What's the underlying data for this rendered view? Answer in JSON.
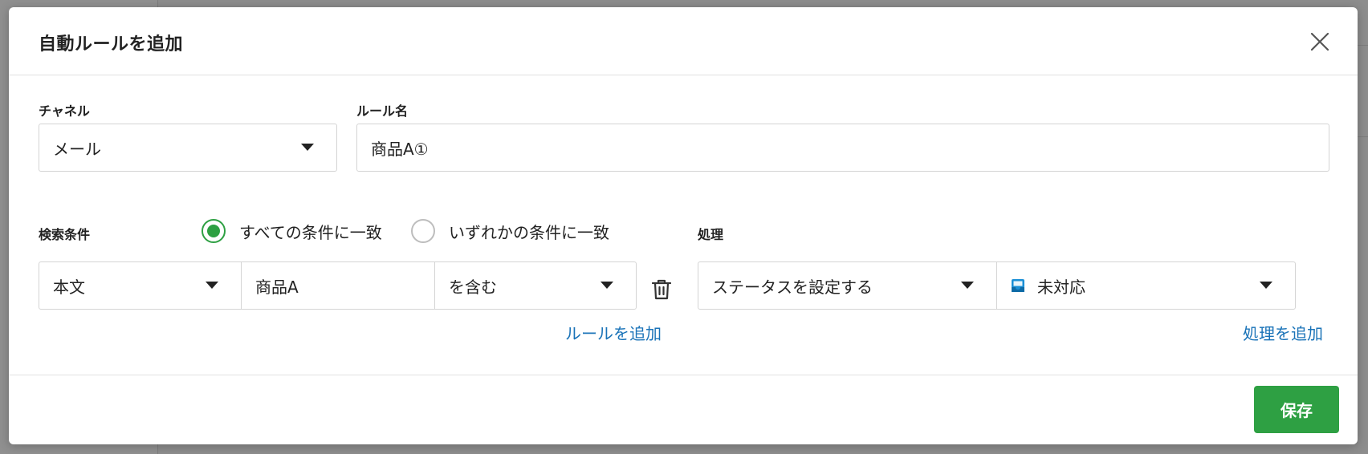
{
  "modal": {
    "title": "自動ルールを追加"
  },
  "channel": {
    "label": "チャネル",
    "value": "メール"
  },
  "rule_name": {
    "label": "ルール名",
    "value": "商品A①"
  },
  "conditions": {
    "label": "検索条件",
    "match_options": [
      {
        "label": "すべての条件に一致",
        "selected": true
      },
      {
        "label": "いずれかの条件に一致",
        "selected": false
      }
    ],
    "rows": [
      {
        "field": "本文",
        "value": "商品A",
        "operator": "を含む"
      }
    ],
    "add_label": "ルールを追加"
  },
  "actions": {
    "label": "処理",
    "rows": [
      {
        "action": "ステータスを設定する",
        "status": "未対応"
      }
    ],
    "add_label": "処理を追加"
  },
  "footer": {
    "save_label": "保存"
  },
  "colors": {
    "accent_green": "#2ea043",
    "link_blue": "#1a73b8",
    "status_icon_blue": "#1a8fd6"
  }
}
